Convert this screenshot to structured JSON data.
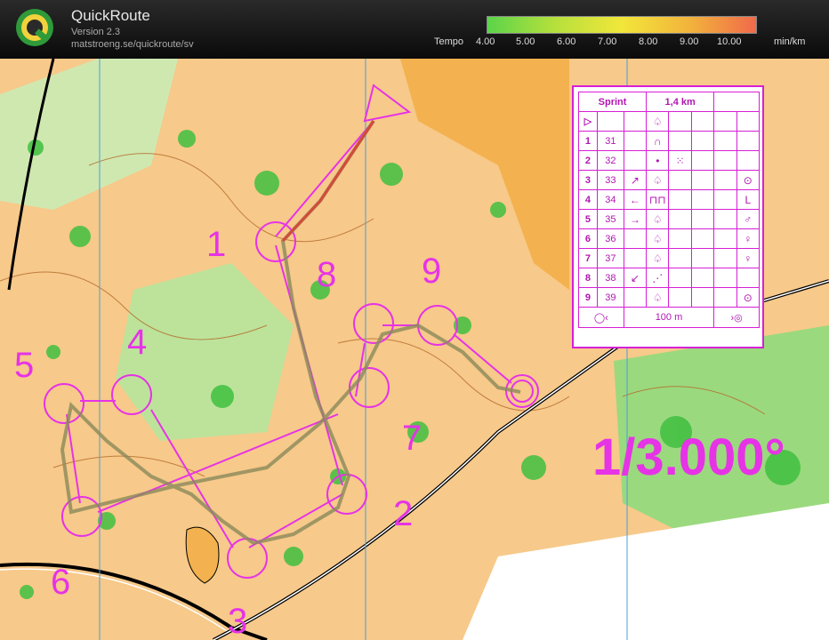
{
  "app": {
    "title": "QuickRoute",
    "version": "Version 2.3",
    "url": "matstroeng.se/quickroute/sv"
  },
  "tempo": {
    "label": "Tempo",
    "ticks": [
      "4.00",
      "5.00",
      "6.00",
      "7.00",
      "8.00",
      "9.00",
      "10.00"
    ],
    "unit": "min/km",
    "colors": [
      "#5bd44a",
      "#b6e03c",
      "#f2e63a",
      "#f2b43c",
      "#f06a4a"
    ]
  },
  "map": {
    "scale_label": "1/3.000°",
    "control_numbers": [
      "1",
      "2",
      "3",
      "4",
      "5",
      "6",
      "7",
      "8",
      "9"
    ]
  },
  "control_card": {
    "event": "Sprint",
    "distance": "1,4 km",
    "rows": [
      {
        "num": "1",
        "code": "31",
        "c": "",
        "d": "∩",
        "e": "",
        "f": "",
        "g": ""
      },
      {
        "num": "2",
        "code": "32",
        "c": "",
        "d": "•",
        "e": "⁙",
        "f": "",
        "g": ""
      },
      {
        "num": "3",
        "code": "33",
        "c": "↗",
        "d": "♤",
        "e": "",
        "f": "",
        "g": "⊙"
      },
      {
        "num": "4",
        "code": "34",
        "c": "←",
        "d": "⊓⊓",
        "e": "",
        "f": "",
        "g": "L"
      },
      {
        "num": "5",
        "code": "35",
        "c": "→",
        "d": "♤",
        "e": "",
        "f": "",
        "g": "♂"
      },
      {
        "num": "6",
        "code": "36",
        "c": "",
        "d": "♤",
        "e": "",
        "f": "",
        "g": "♀"
      },
      {
        "num": "7",
        "code": "37",
        "c": "",
        "d": "♤",
        "e": "",
        "f": "",
        "g": "♀"
      },
      {
        "num": "8",
        "code": "38",
        "c": "↙",
        "d": "⋰",
        "e": "",
        "f": "",
        "g": ""
      },
      {
        "num": "9",
        "code": "39",
        "c": "",
        "d": "♤",
        "e": "",
        "f": "",
        "g": "⊙"
      }
    ],
    "finish_distance": "100 m",
    "start_symbol": "▷",
    "start_d": "♤"
  }
}
